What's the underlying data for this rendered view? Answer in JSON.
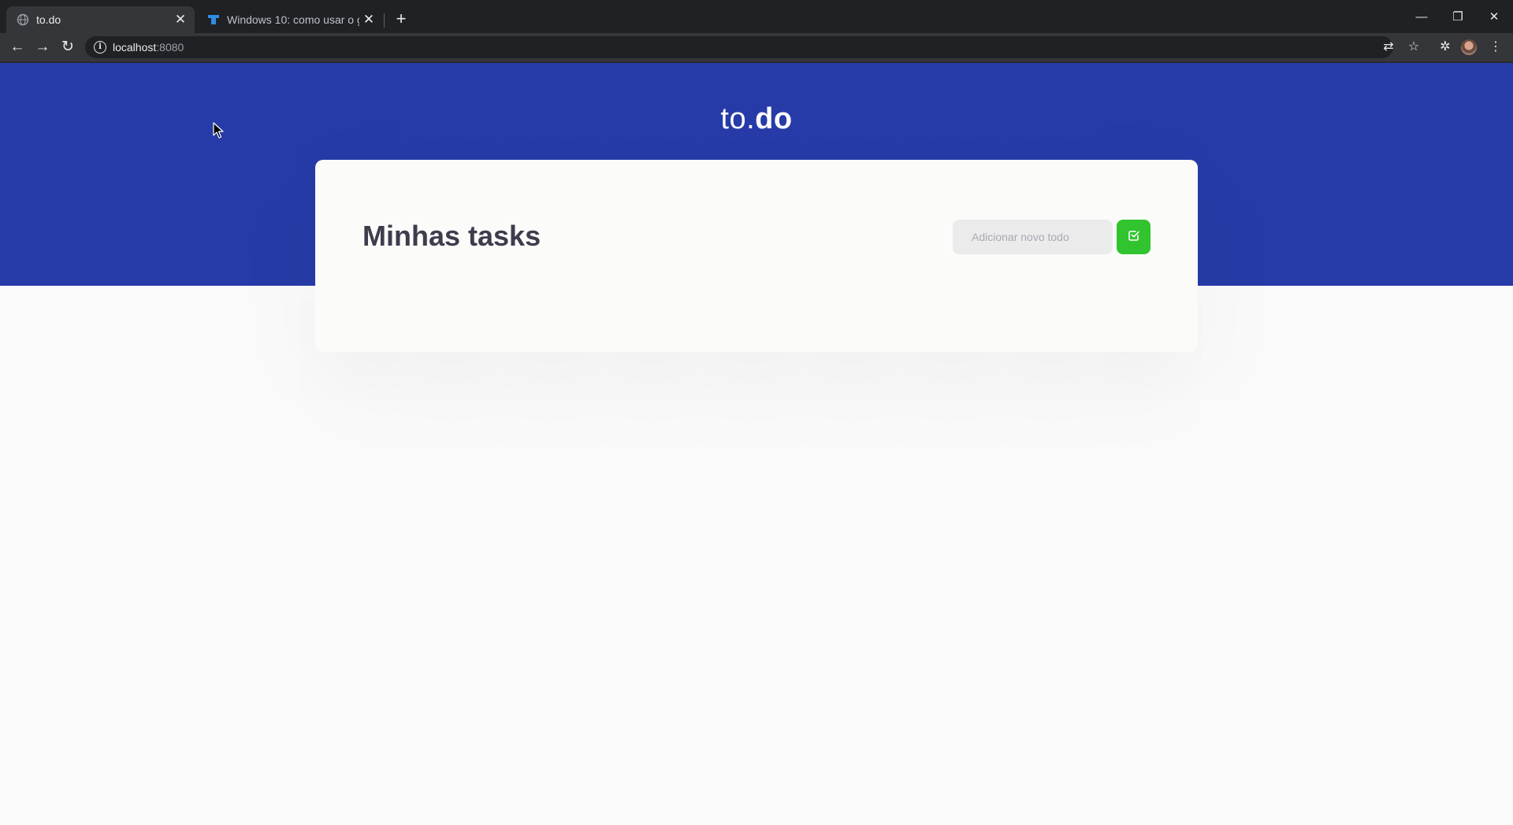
{
  "browser": {
    "tabs": [
      {
        "title": "to.do",
        "active": true,
        "favicon": "globe-icon"
      },
      {
        "title": "Windows 10: como usar o g",
        "active": false,
        "favicon": "site-favicon"
      }
    ],
    "close_glyph": "✕",
    "new_tab_glyph": "+",
    "window_controls": {
      "minimize": "—",
      "restore": "❐",
      "close": "✕"
    },
    "nav": {
      "back": "←",
      "forward": "→",
      "reload": "↻"
    },
    "address": {
      "host": "localhost",
      "port": ":8080"
    },
    "toolbar_icons": {
      "translate": "⇄",
      "bookmark": "☆",
      "extensions": "✲",
      "menu": "⋮"
    },
    "accent_dark": "#202124",
    "toolbar_color": "#35363a"
  },
  "page": {
    "logo": {
      "light": "to.",
      "bold": "do"
    },
    "hero_color": "#273ba8",
    "card": {
      "title": "Minhas tasks",
      "input_placeholder": "Adicionar novo todo",
      "input_value": "",
      "add_button_icon": "checkbox-check-icon",
      "add_button_color": "#31c42f"
    }
  }
}
